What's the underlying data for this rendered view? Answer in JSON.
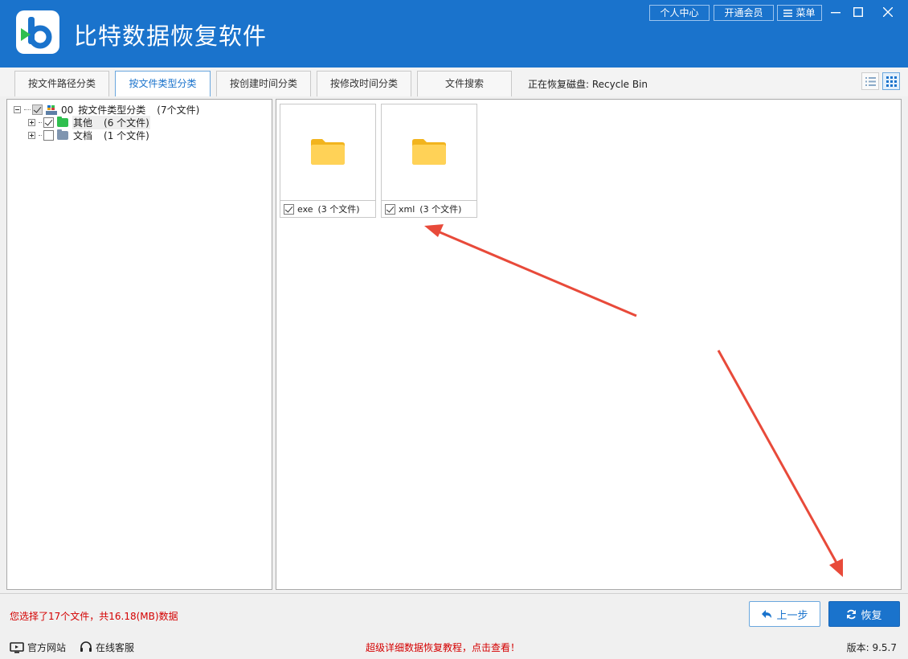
{
  "app": {
    "title": "比特数据恢复软件",
    "accent_color": "#1a73cc"
  },
  "titlebar": {
    "personal_center": "个人中心",
    "vip": "开通会员",
    "menu": "菜单"
  },
  "tabs": [
    {
      "label": "按文件路径分类",
      "active": false
    },
    {
      "label": "按文件类型分类",
      "active": true
    },
    {
      "label": "按创建时间分类",
      "active": false
    },
    {
      "label": "按修改时间分类",
      "active": false
    },
    {
      "label": "文件搜索",
      "active": false
    }
  ],
  "recovering_disk": "正在恢复磁盘: Recycle Bin",
  "view_modes": [
    "list-view-icon",
    "grid-view-icon"
  ],
  "tree": {
    "root": {
      "name": "00",
      "label": "按文件类型分类",
      "count": "(7个文件)"
    },
    "children": [
      {
        "label": "其他",
        "count": "(6 个文件)",
        "checked": true,
        "folder_color": "#2fbf4f"
      },
      {
        "label": "文档",
        "count": "(1 个文件)",
        "checked": false,
        "folder_color": "#7f95b0"
      }
    ]
  },
  "files": [
    {
      "name": "exe",
      "count": "(3 个文件)",
      "checked": true
    },
    {
      "name": "xml",
      "count": "(3 个文件)",
      "checked": true
    }
  ],
  "footer": {
    "selected_info": "您选择了17个文件，共16.18(MB)数据",
    "prev_button": "上一步",
    "recover_button": "恢复",
    "website": "官方网站",
    "support": "在线客服",
    "tutorial": "超级详细数据恢复教程，点击查看！",
    "version": "版本: 9.5.7"
  }
}
